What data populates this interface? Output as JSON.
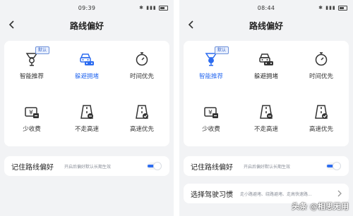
{
  "colors": {
    "accent": "#2c6cf0",
    "background": "#f2f3f5",
    "card": "#ffffff"
  },
  "screens": [
    {
      "status_time": "09:39",
      "title": "路线偏好",
      "badge": "默认",
      "options": [
        {
          "label": "智能推荐",
          "icon": "smart-recommend-icon"
        },
        {
          "label": "躲避拥堵",
          "icon": "avoid-congestion-icon"
        },
        {
          "label": "时间优先",
          "icon": "stopwatch-icon"
        },
        {
          "label": "少收费",
          "icon": "less-toll-icon"
        },
        {
          "label": "不走高速",
          "icon": "no-highway-icon"
        },
        {
          "label": "高速优先",
          "icon": "highway-first-icon"
        }
      ],
      "selected": "躲避拥堵",
      "remember_title": "记住路线偏好",
      "remember_sub": "开启后偏好默认长期生效",
      "remember_on": true
    },
    {
      "status_time": "08:44",
      "title": "路线偏好",
      "badge": "默认",
      "options": [
        {
          "label": "智能推荐",
          "icon": "smart-recommend-icon"
        },
        {
          "label": "躲避拥堵",
          "icon": "avoid-congestion-icon"
        },
        {
          "label": "时间优先",
          "icon": "stopwatch-icon"
        },
        {
          "label": "少收费",
          "icon": "less-toll-icon"
        },
        {
          "label": "不走高速",
          "icon": "no-highway-icon"
        },
        {
          "label": "高速优先",
          "icon": "highway-first-icon"
        }
      ],
      "selected": "智能推荐",
      "remember_title": "记住路线偏好",
      "remember_sub": "开启后偏好默认长期生效",
      "remember_on": true,
      "habit_title": "选择驾驶习惯",
      "habit_sub": "走小路避堵、绕路避堵、走高快速路..."
    }
  ],
  "watermark": "头条 @相思无用"
}
